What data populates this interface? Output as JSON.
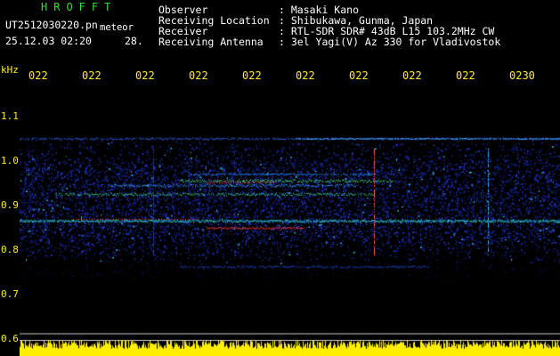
{
  "header": {
    "title": "HROFFT",
    "file_name": "UT2512030220.pn",
    "file_tag": "meteor",
    "timestamp": "25.12.03 02:20",
    "seconds": "28.",
    "info": [
      {
        "label": "Observer",
        "value": ": Masaki Kano"
      },
      {
        "label": "Receiving Location",
        "value": ": Shibukawa, Gunma, Japan"
      },
      {
        "label": "Receiver",
        "value": ": RTL-SDR SDR# 43dB L15 103.2MHz CW"
      },
      {
        "label": "Receiving Antenna",
        "value": ": 3el Yagi(V) Az 330 for Vladivostok"
      }
    ]
  },
  "axis": {
    "unit": "kHz",
    "y_labels": [
      "1.1",
      "1.0",
      "0.9",
      "0.8",
      "0.7",
      "0.6"
    ],
    "x_ticks": [
      "022",
      "022",
      "022",
      "022",
      "022",
      "022",
      "022",
      "022",
      "022",
      "0230"
    ]
  },
  "colors": {
    "text_green": "#33dd33",
    "text_white": "#ffffff",
    "text_yellow": "#ffee22",
    "noise_blue": "#2233cc",
    "hot_red": "#ff3322",
    "level_yellow": "#ffee00"
  }
}
